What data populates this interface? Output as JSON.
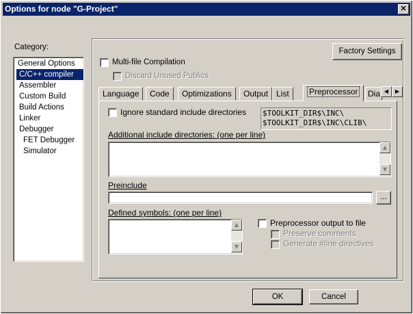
{
  "window": {
    "title": "Options for node \"G-Project\"",
    "close": "✕"
  },
  "category": {
    "label": "Category:",
    "items": [
      {
        "label": "General Options"
      },
      {
        "label": "C/C++ compiler"
      },
      {
        "label": "Assembler"
      },
      {
        "label": "Custom Build"
      },
      {
        "label": "Build Actions"
      },
      {
        "label": "Linker"
      },
      {
        "label": "Debugger"
      },
      {
        "label": "FET Debugger"
      },
      {
        "label": "Simulator"
      }
    ],
    "selected": "C/C++ compiler"
  },
  "factory_settings": "Factory Settings",
  "multifile": {
    "label": "Multi-file Compilation",
    "checked": false
  },
  "discard": {
    "label": "Discard Unused Publics",
    "checked": false
  },
  "tabs": [
    "Language",
    "Code",
    "Optimizations",
    "Output",
    "List",
    "Preprocessor",
    "Dia"
  ],
  "active_tab": "Preprocessor",
  "ignore_std": {
    "label": "Ignore standard include directories",
    "checked": false
  },
  "std_dirs": [
    "$TOOLKIT_DIR$\\INC\\",
    "$TOOLKIT_DIR$\\INC\\CLIB\\"
  ],
  "additional_label": "Additional include directories: (one per line)",
  "preinclude": {
    "label": "Preinclude",
    "value": "",
    "browse": "..."
  },
  "defined_label": "Defined symbols: (one per line)",
  "pp_output": {
    "label": "Preprocessor output to file",
    "checked": false
  },
  "preserve_comments": {
    "label": "Preserve comments",
    "checked": false
  },
  "line_directives": {
    "label": "Generate #line directives",
    "checked": false
  },
  "buttons": {
    "ok": "OK",
    "cancel": "Cancel"
  },
  "icons": {
    "up": "▲",
    "down": "▼",
    "left": "◀",
    "right": "▶"
  }
}
